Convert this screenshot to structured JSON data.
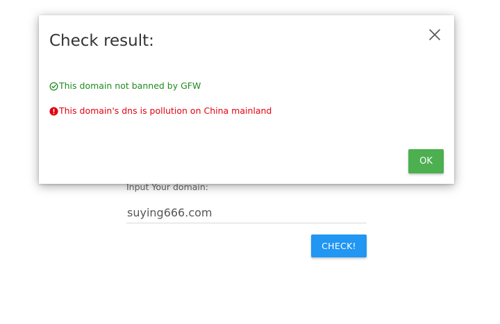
{
  "form": {
    "label": "Input Your domain:",
    "domain_value": "suying666.com",
    "check_label": "CHECK!"
  },
  "modal": {
    "title": "Check result:",
    "messages": {
      "gfw": "This domain not banned by GFW",
      "dns": "This domain's dns is pollution on China mainland"
    },
    "ok_label": "OK"
  },
  "icons": {
    "gfw_status": "check-circle-icon",
    "dns_status": "exclamation-circle-icon",
    "close": "close-icon"
  },
  "colors": {
    "success_text": "#1e8a1e",
    "error_text": "#e3000f",
    "ok_button": "#4caf50",
    "check_button": "#2196f3"
  }
}
